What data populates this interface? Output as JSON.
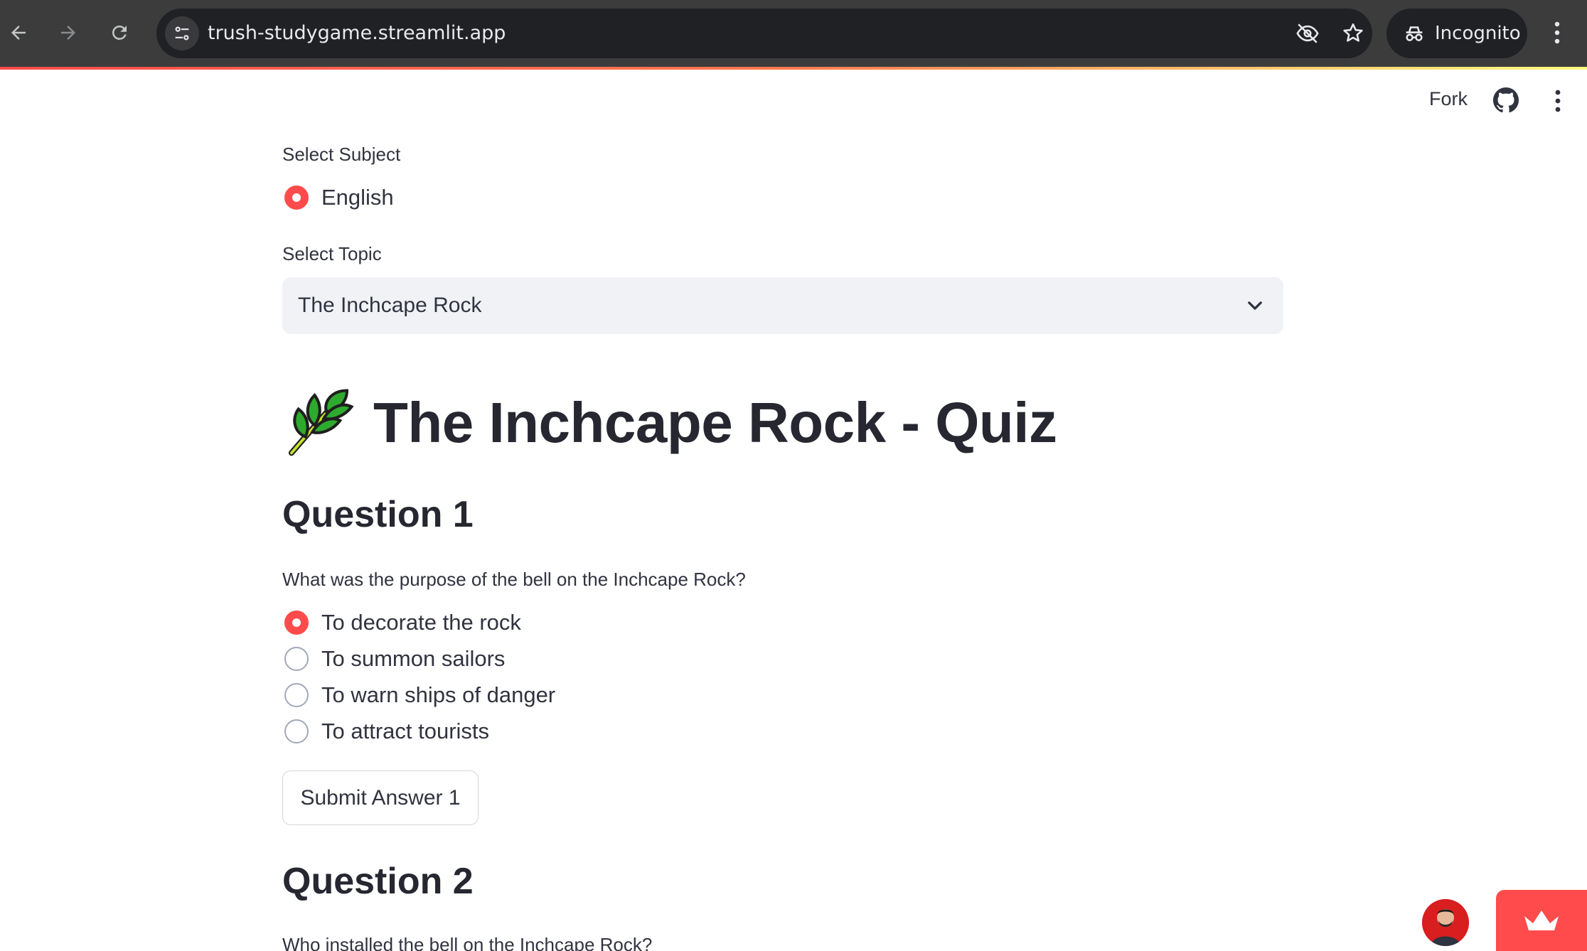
{
  "browser": {
    "url": "trush-studygame.streamlit.app",
    "incognito_label": "Incognito",
    "icons": [
      "back-arrow-icon",
      "forward-arrow-icon",
      "reload-icon",
      "site-info-icon",
      "eye-slash-icon",
      "star-icon",
      "incognito-icon",
      "more-vert-icon"
    ]
  },
  "header": {
    "fork_label": "Fork",
    "icons": [
      "github-icon",
      "more-vert-icon"
    ]
  },
  "subject": {
    "label": "Select Subject",
    "options": [
      {
        "label": "English",
        "selected": true
      }
    ]
  },
  "topic": {
    "label": "Select Topic",
    "selected": "The Inchcape Rock"
  },
  "title": {
    "icon": "herb-icon",
    "text": "The Inchcape Rock - Quiz"
  },
  "questions": [
    {
      "heading": "Question 1",
      "text": "What was the purpose of the bell on the Inchcape Rock?",
      "options": [
        {
          "label": "To decorate the rock",
          "selected": true
        },
        {
          "label": "To summon sailors",
          "selected": false
        },
        {
          "label": "To warn ships of danger",
          "selected": false
        },
        {
          "label": "To attract tourists",
          "selected": false
        }
      ],
      "submit_label": "Submit Answer 1"
    },
    {
      "heading": "Question 2",
      "text": "Who installed the bell on the Inchcape Rock?"
    }
  ],
  "colors": {
    "accent": "#ff4b4b",
    "text": "#31333f",
    "select_bg": "#f0f2f6",
    "chrome_bg": "#3c3c3c"
  }
}
